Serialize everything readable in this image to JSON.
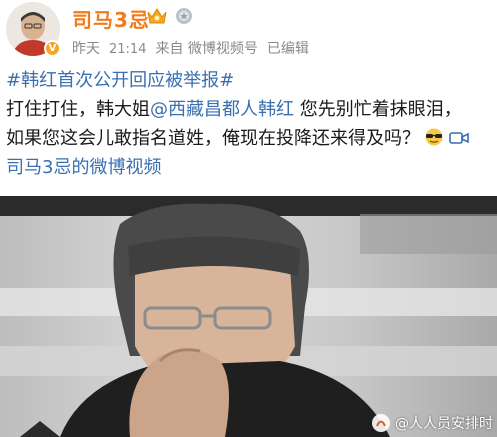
{
  "post": {
    "author": {
      "name": "司马3忌"
    },
    "meta": {
      "date": "昨天",
      "time": "21:14",
      "source": "来自 微博视频号",
      "edited": "已编辑"
    },
    "topic": "#韩红首次公开回应被举报#",
    "text_line1_a": "打住打住，韩大姐",
    "mention": "@西藏昌都人韩红",
    "text_line1_b": " 您先别忙着抹眼泪，",
    "text_line2": "如果您这会儿敢指名道姓，俺现在投降还来得及吗？",
    "video_link": "司马3忌的微博视频"
  },
  "video": {
    "watermark": "@人人员安排时"
  },
  "colors": {
    "username": "#f17c1e",
    "link": "#3a6fb0",
    "meta": "#8a8a8a",
    "verified": "#f5a623"
  },
  "icons": [
    "verified-icon",
    "vip-crown-icon",
    "level-icon",
    "sunglasses-emoji-icon",
    "video-icon",
    "watermark-logo-icon"
  ]
}
